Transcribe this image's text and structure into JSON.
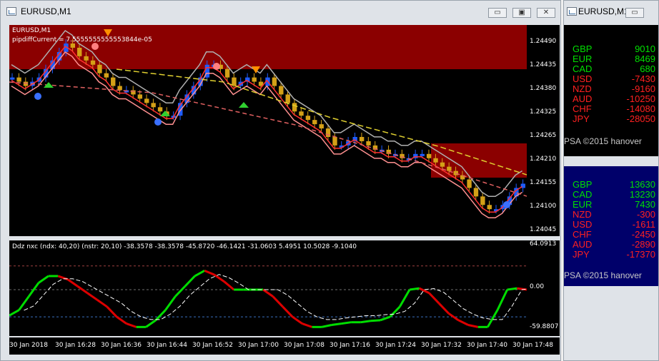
{
  "main_window": {
    "title": "EURUSD,M1",
    "buttons": {
      "minimize": "▭",
      "restore": "▣",
      "close": "✕"
    },
    "chart_label": "EURUSD,M1",
    "pip_label": "pipdiffCurrent = 7.5555555555553844e-05",
    "price_levels": [
      "1.24490",
      "1.24435",
      "1.24380",
      "1.24325",
      "1.24265",
      "1.24210",
      "1.24155",
      "1.24100",
      "1.24045"
    ],
    "indicator_label": "Ddz nxc (ndx: 40,20) (nstr: 20,10) -38.3578 -38.3578 -45.8720 -46.1421 -31.0603 5.4951 10.5028 -9.1040",
    "indicator_levels": [
      "64.0913",
      "0.00",
      "-59.8807"
    ],
    "time_labels": [
      "30 Jan 2018",
      "30 Jan 16:28",
      "30 Jan 16:36",
      "30 Jan 16:44",
      "30 Jan 16:52",
      "30 Jan 17:00",
      "30 Jan 17:08",
      "30 Jan 17:16",
      "30 Jan 17:24",
      "30 Jan 17:32",
      "30 Jan 17:40",
      "30 Jan 17:48"
    ]
  },
  "side_window": {
    "title": "EURUSD,M1",
    "panel1": {
      "rows": [
        {
          "code": "GBP",
          "value": "9010",
          "color": "#00e000"
        },
        {
          "code": "EUR",
          "value": "8469",
          "color": "#00e000"
        },
        {
          "code": "CAD",
          "value": "680",
          "color": "#00e000"
        },
        {
          "code": "USD",
          "value": "-7430",
          "color": "#ff2020"
        },
        {
          "code": "NZD",
          "value": "-9160",
          "color": "#ff2020"
        },
        {
          "code": "AUD",
          "value": "-10250",
          "color": "#ff2020"
        },
        {
          "code": "CHF",
          "value": "-14080",
          "color": "#ff2020"
        },
        {
          "code": "JPY",
          "value": "-28050",
          "color": "#ff2020"
        }
      ],
      "footer": "PSA ©2015 hanover"
    },
    "panel2": {
      "rows": [
        {
          "code": "GBP",
          "value": "13630",
          "color": "#00e000"
        },
        {
          "code": "CAD",
          "value": "13230",
          "color": "#00e000"
        },
        {
          "code": "EUR",
          "value": "7430",
          "color": "#00e000"
        },
        {
          "code": "NZD",
          "value": "-300",
          "color": "#ff2020"
        },
        {
          "code": "USD",
          "value": "-1611",
          "color": "#ff2020"
        },
        {
          "code": "CHF",
          "value": "-2450",
          "color": "#ff2020"
        },
        {
          "code": "AUD",
          "value": "-2890",
          "color": "#ff2020"
        },
        {
          "code": "JPY",
          "value": "-17370",
          "color": "#ff2020"
        }
      ],
      "footer": "PSA ©2015 hanover"
    }
  },
  "colors": {
    "bull": "#1e5cff",
    "bear": "#d4a017",
    "zone": "#8b0000",
    "osc_up": "#00dd00",
    "osc_down": "#dd0000"
  },
  "chart_data": {
    "type": "candlestick",
    "close": [
      1.244,
      1.2439,
      1.2438,
      1.2439,
      1.244,
      1.2442,
      1.2444,
      1.2446,
      1.2448,
      1.2447,
      1.2445,
      1.2444,
      1.2443,
      1.2441,
      1.244,
      1.2438,
      1.2437,
      1.2437,
      1.2436,
      1.2435,
      1.2434,
      1.2433,
      1.2432,
      1.2431,
      1.2431,
      1.2434,
      1.2436,
      1.2438,
      1.244,
      1.2443,
      1.2443,
      1.2442,
      1.244,
      1.2438,
      1.2439,
      1.244,
      1.2439,
      1.2438,
      1.244,
      1.2438,
      1.2436,
      1.2434,
      1.2432,
      1.2431,
      1.243,
      1.2429,
      1.2428,
      1.2426,
      1.2424,
      1.2424,
      1.2425,
      1.2426,
      1.2425,
      1.2424,
      1.2423,
      1.2423,
      1.2422,
      1.2422,
      1.2421,
      1.2421,
      1.2422,
      1.2422,
      1.2421,
      1.242,
      1.2419,
      1.2418,
      1.2417,
      1.2416,
      1.2414,
      1.2412,
      1.241,
      1.2409,
      1.2409,
      1.241,
      1.2412,
      1.2414,
      1.2415
    ],
    "indicator": [
      -38,
      -30,
      -10,
      10,
      20,
      20,
      15,
      5,
      -5,
      -15,
      -25,
      -40,
      -50,
      -55,
      -55,
      -45,
      -30,
      -10,
      5,
      20,
      28,
      22,
      12,
      0,
      0,
      0,
      0,
      -10,
      -25,
      -40,
      -50,
      -55,
      -55,
      -52,
      -50,
      -48,
      -48,
      -46,
      -45,
      -40,
      -25,
      0,
      2,
      -5,
      -20,
      -35,
      -45,
      -52,
      -55,
      -55,
      -30,
      0,
      2,
      0
    ],
    "ylim": [
      1.24045,
      1.2449
    ],
    "indicator_ylim": [
      -59.8807,
      64.0913
    ]
  }
}
